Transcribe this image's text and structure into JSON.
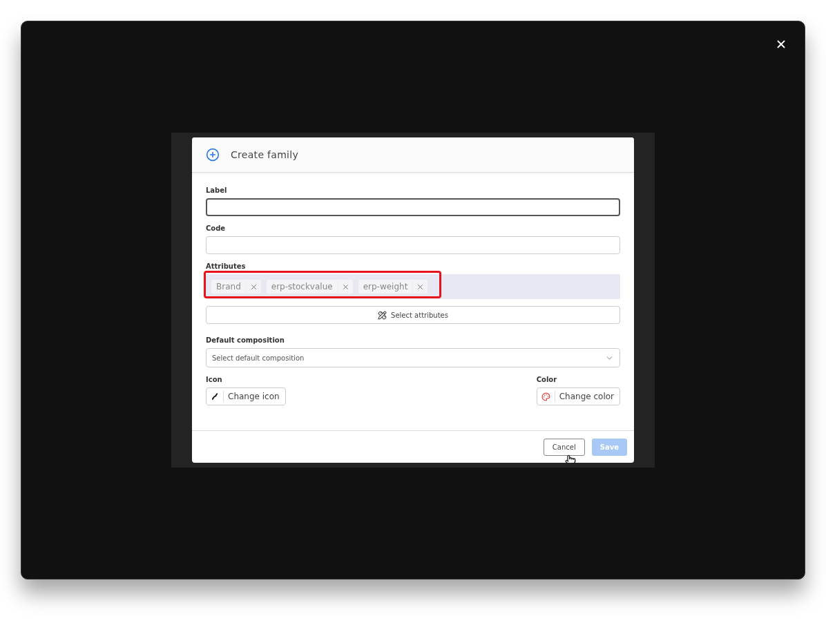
{
  "dialog": {
    "title": "Create family",
    "label_field": {
      "label": "Label",
      "focused": true
    },
    "code_field": {
      "label": "Code"
    },
    "attributes": {
      "label": "Attributes",
      "highlighted": true,
      "tags": [
        {
          "label": "Brand"
        },
        {
          "label": "erp-stockvalue"
        },
        {
          "label": "erp-weight"
        }
      ],
      "select_button": "Select attributes"
    },
    "default_composition": {
      "label": "Default composition",
      "placeholder": "Select default composition"
    },
    "icon": {
      "label": "Icon",
      "button": "Change icon"
    },
    "color": {
      "label": "Color",
      "button": "Change color"
    },
    "buttons": [
      {
        "label": "Cancel",
        "kind": "secondary",
        "disabled": false
      },
      {
        "label": "Save",
        "kind": "primary",
        "disabled": true
      }
    ]
  }
}
